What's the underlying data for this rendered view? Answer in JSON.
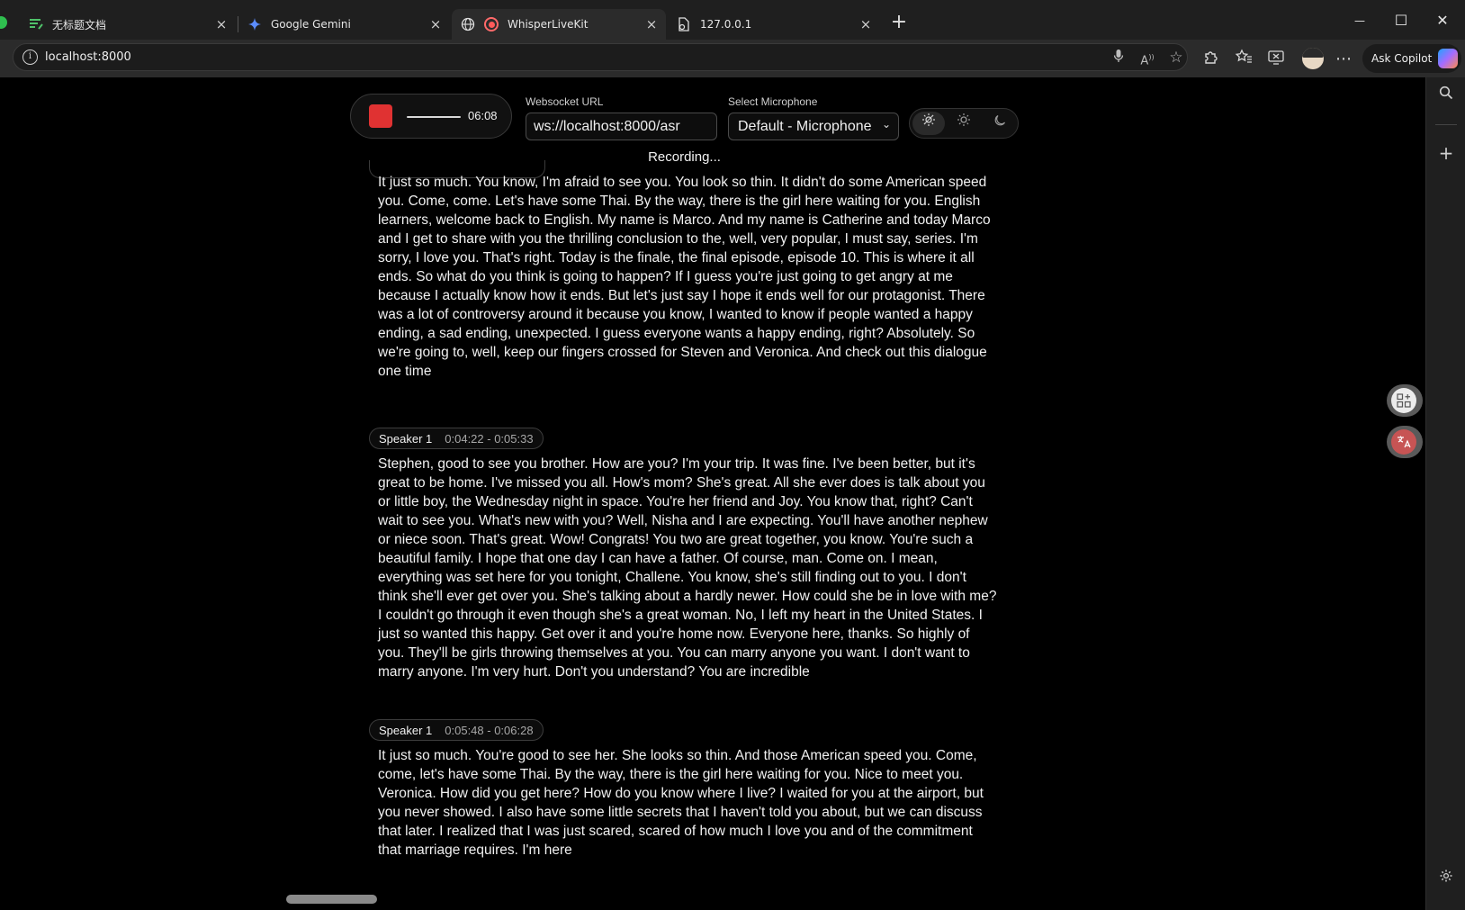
{
  "browser": {
    "tabs": [
      {
        "label": "无标题文档",
        "favicon": "doc-lines-icon",
        "active": false
      },
      {
        "label": "Google Gemini",
        "favicon": "gemini-sparkle-icon",
        "active": false
      },
      {
        "label": "WhisperLiveKit",
        "favicon": "globe-icon",
        "active": true
      },
      {
        "label": "127.0.0.1",
        "favicon": "page-icon",
        "active": false
      }
    ],
    "tab_close_glyph": "×",
    "new_tab_glyph": "+",
    "window_controls": {
      "minimize": "—",
      "maximize": "☐",
      "close": "✕"
    },
    "address": "localhost:8000",
    "copilot_label": "Ask Copilot"
  },
  "recorder": {
    "timer": "06:08",
    "websocket_label": "Websocket URL",
    "websocket_value": "ws://localhost:8000/asr",
    "mic_label": "Select Microphone",
    "mic_value": "Default - Microphone",
    "theme_options": [
      "system",
      "light",
      "dark"
    ],
    "status": "Recording..."
  },
  "transcript": {
    "segments": [
      {
        "speaker": "",
        "range": "",
        "text": "It just so much. You know, I'm afraid to see you. You look so thin. It didn't do some American speed you. Come, come. Let's have some Thai. By the way, there is the girl here waiting for you. English learners, welcome back to English. My name is Marco. And my name is Catherine and today Marco and I get to share with you the thrilling conclusion to the, well, very popular, I must say, series. I'm sorry, I love you. That's right. Today is the finale, the final episode, episode 10. This is where it all ends. So what do you think is going to happen? If I guess you're just going to get angry at me because I actually know how it ends. But let's just say I hope it ends well for our protagonist. There was a lot of controversy around it because you know, I wanted to know if people wanted a happy ending, a sad ending, unexpected. I guess everyone wants a happy ending, right? Absolutely. So we're going to, well, keep our fingers crossed for Steven and Veronica. And check out this dialogue one time"
      },
      {
        "speaker": "Speaker 1",
        "range": "0:04:22 - 0:05:33",
        "text": "Stephen, good to see you brother. How are you? I'm your trip. It was fine. I've been better, but it's great to be home. I've missed you all. How's mom? She's great. All she ever does is talk about you or little boy, the Wednesday night in space. You're her friend and Joy. You know that, right? Can't wait to see you. What's new with you? Well, Nisha and I are expecting. You'll have another nephew or niece soon. That's great. Wow! Congrats! You two are great together, you know. You're such a beautiful family. I hope that one day I can have a father. Of course, man. Come on. I mean, everything was set here for you tonight, Challene. You know, she's still finding out to you. I don't think she'll ever get over you. She's talking about a hardly newer. How could she be in love with me? I couldn't go through it even though she's a great woman. No, I left my heart in the United States. I just so wanted this happy. Get over it and you're home now. Everyone here, thanks. So highly of you. They'll be girls throwing themselves at you. You can marry anyone you want. I don't want to marry anyone. I'm very hurt. Don't you understand? You are incredible"
      },
      {
        "speaker": "Speaker 1",
        "range": "0:05:48 - 0:06:28",
        "text": "It just so much. You're good to see her. She looks so thin. And those American speed you. Come, come, let's have some Thai. By the way, there is the girl here waiting for you. Nice to meet you. Veronica. How did you get here? How do you know where I live? I waited for you at the airport, but you never showed. I also have some little secrets that I haven't told you about, but we can discuss that later. I realized that I was just scared, scared of how much I love you and of the commitment that marriage requires. I'm here"
      }
    ]
  },
  "colors": {
    "record": "#e03232",
    "background": "#000000",
    "chrome": "#2b2b2b"
  }
}
